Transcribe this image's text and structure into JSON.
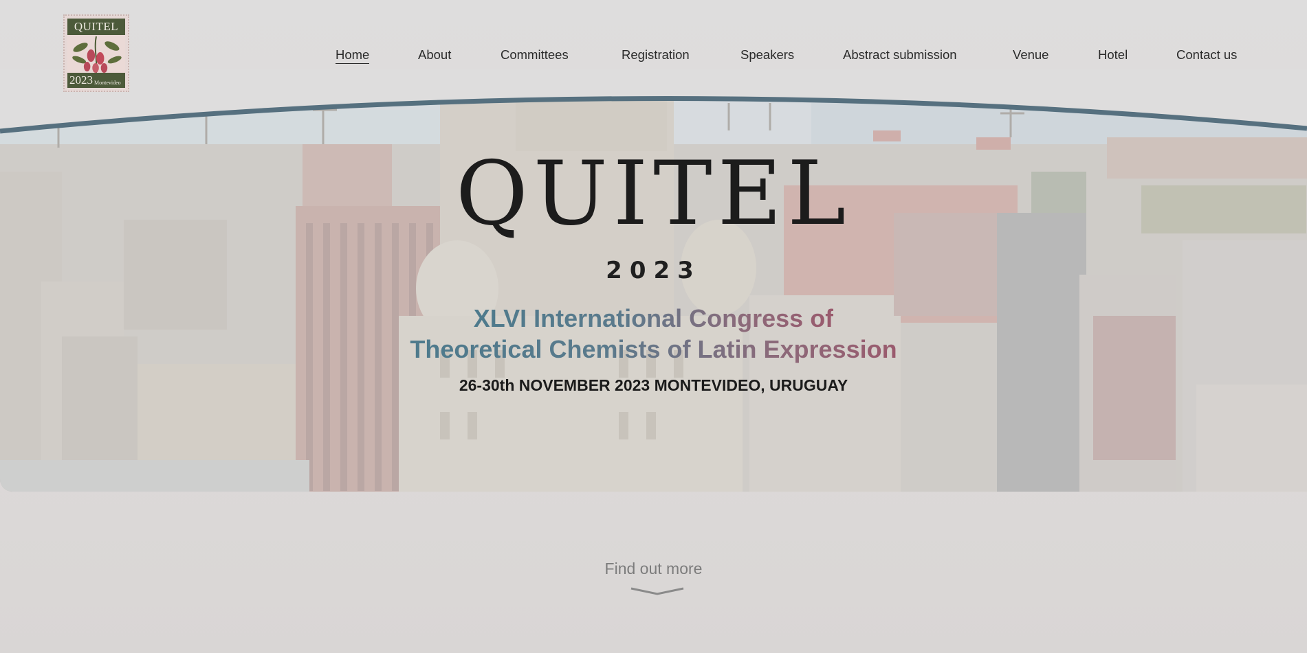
{
  "logo": {
    "top_text": "QUITEL",
    "year": "2023",
    "city": "Montevideo"
  },
  "nav": [
    {
      "label": "Home",
      "active": true
    },
    {
      "label": "About"
    },
    {
      "label": "Committees"
    },
    {
      "label": "Registration"
    },
    {
      "label": "Speakers"
    },
    {
      "label": "Abstract submission"
    },
    {
      "label": "Venue"
    },
    {
      "label": "Hotel"
    },
    {
      "label": "Contact us"
    }
  ],
  "hero": {
    "title": "QUITEL",
    "year": "2023",
    "subtitle_line1": "XLVI International Congress of",
    "subtitle_line2": "Theoretical Chemists of Latin Expression",
    "dates": "26-30th NOVEMBER 2023 MONTEVIDEO, URUGUAY"
  },
  "find_more": {
    "label": "Find out more",
    "icon": "chevron-down-icon"
  },
  "colors": {
    "arc": "#56707f",
    "subtitle_start": "#4d7a8c",
    "subtitle_end": "#9a5a6d",
    "logo_green": "#4c5a3a"
  }
}
